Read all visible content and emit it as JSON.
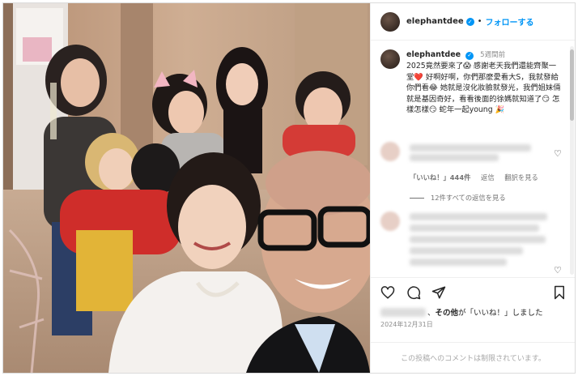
{
  "post": {
    "username": "elephantdee",
    "follow_label": "フォローする",
    "separator": "•",
    "caption": {
      "username": "elephantdee",
      "time": "5週間前",
      "text": "2025竟然要來了😱 感謝老天我們還能齊聚一堂❤️ 好啊好啊，你們那麼愛看大S，我就發給你們看😂 她就是沒化妝臉就發光，我們姐妹倆就是基因奇好，看看後面的徐媽就知道了😏 怎樣怎樣😏 蛇年一起young 🎉"
    },
    "comment": {
      "likes_label": "「いいね！」444件",
      "reply_label": "返信",
      "translate_label": "翻訳を見る",
      "view_replies_label": "12件すべての返信を見る"
    },
    "liked_by": {
      "text_bold": "その他",
      "text_suffix": "が「いいね！」しました",
      "separator": "、"
    },
    "date": "2024年12月31日",
    "comments_disabled": "この投稿へのコメントは制限されています。"
  },
  "icons": {
    "verified": "verified-badge-icon",
    "heart": "heart-icon",
    "comment": "comment-icon",
    "share": "share-icon",
    "bookmark": "bookmark-icon"
  },
  "colors": {
    "accent": "#0095f6",
    "muted": "#737373",
    "border": "#dbdbdb"
  }
}
